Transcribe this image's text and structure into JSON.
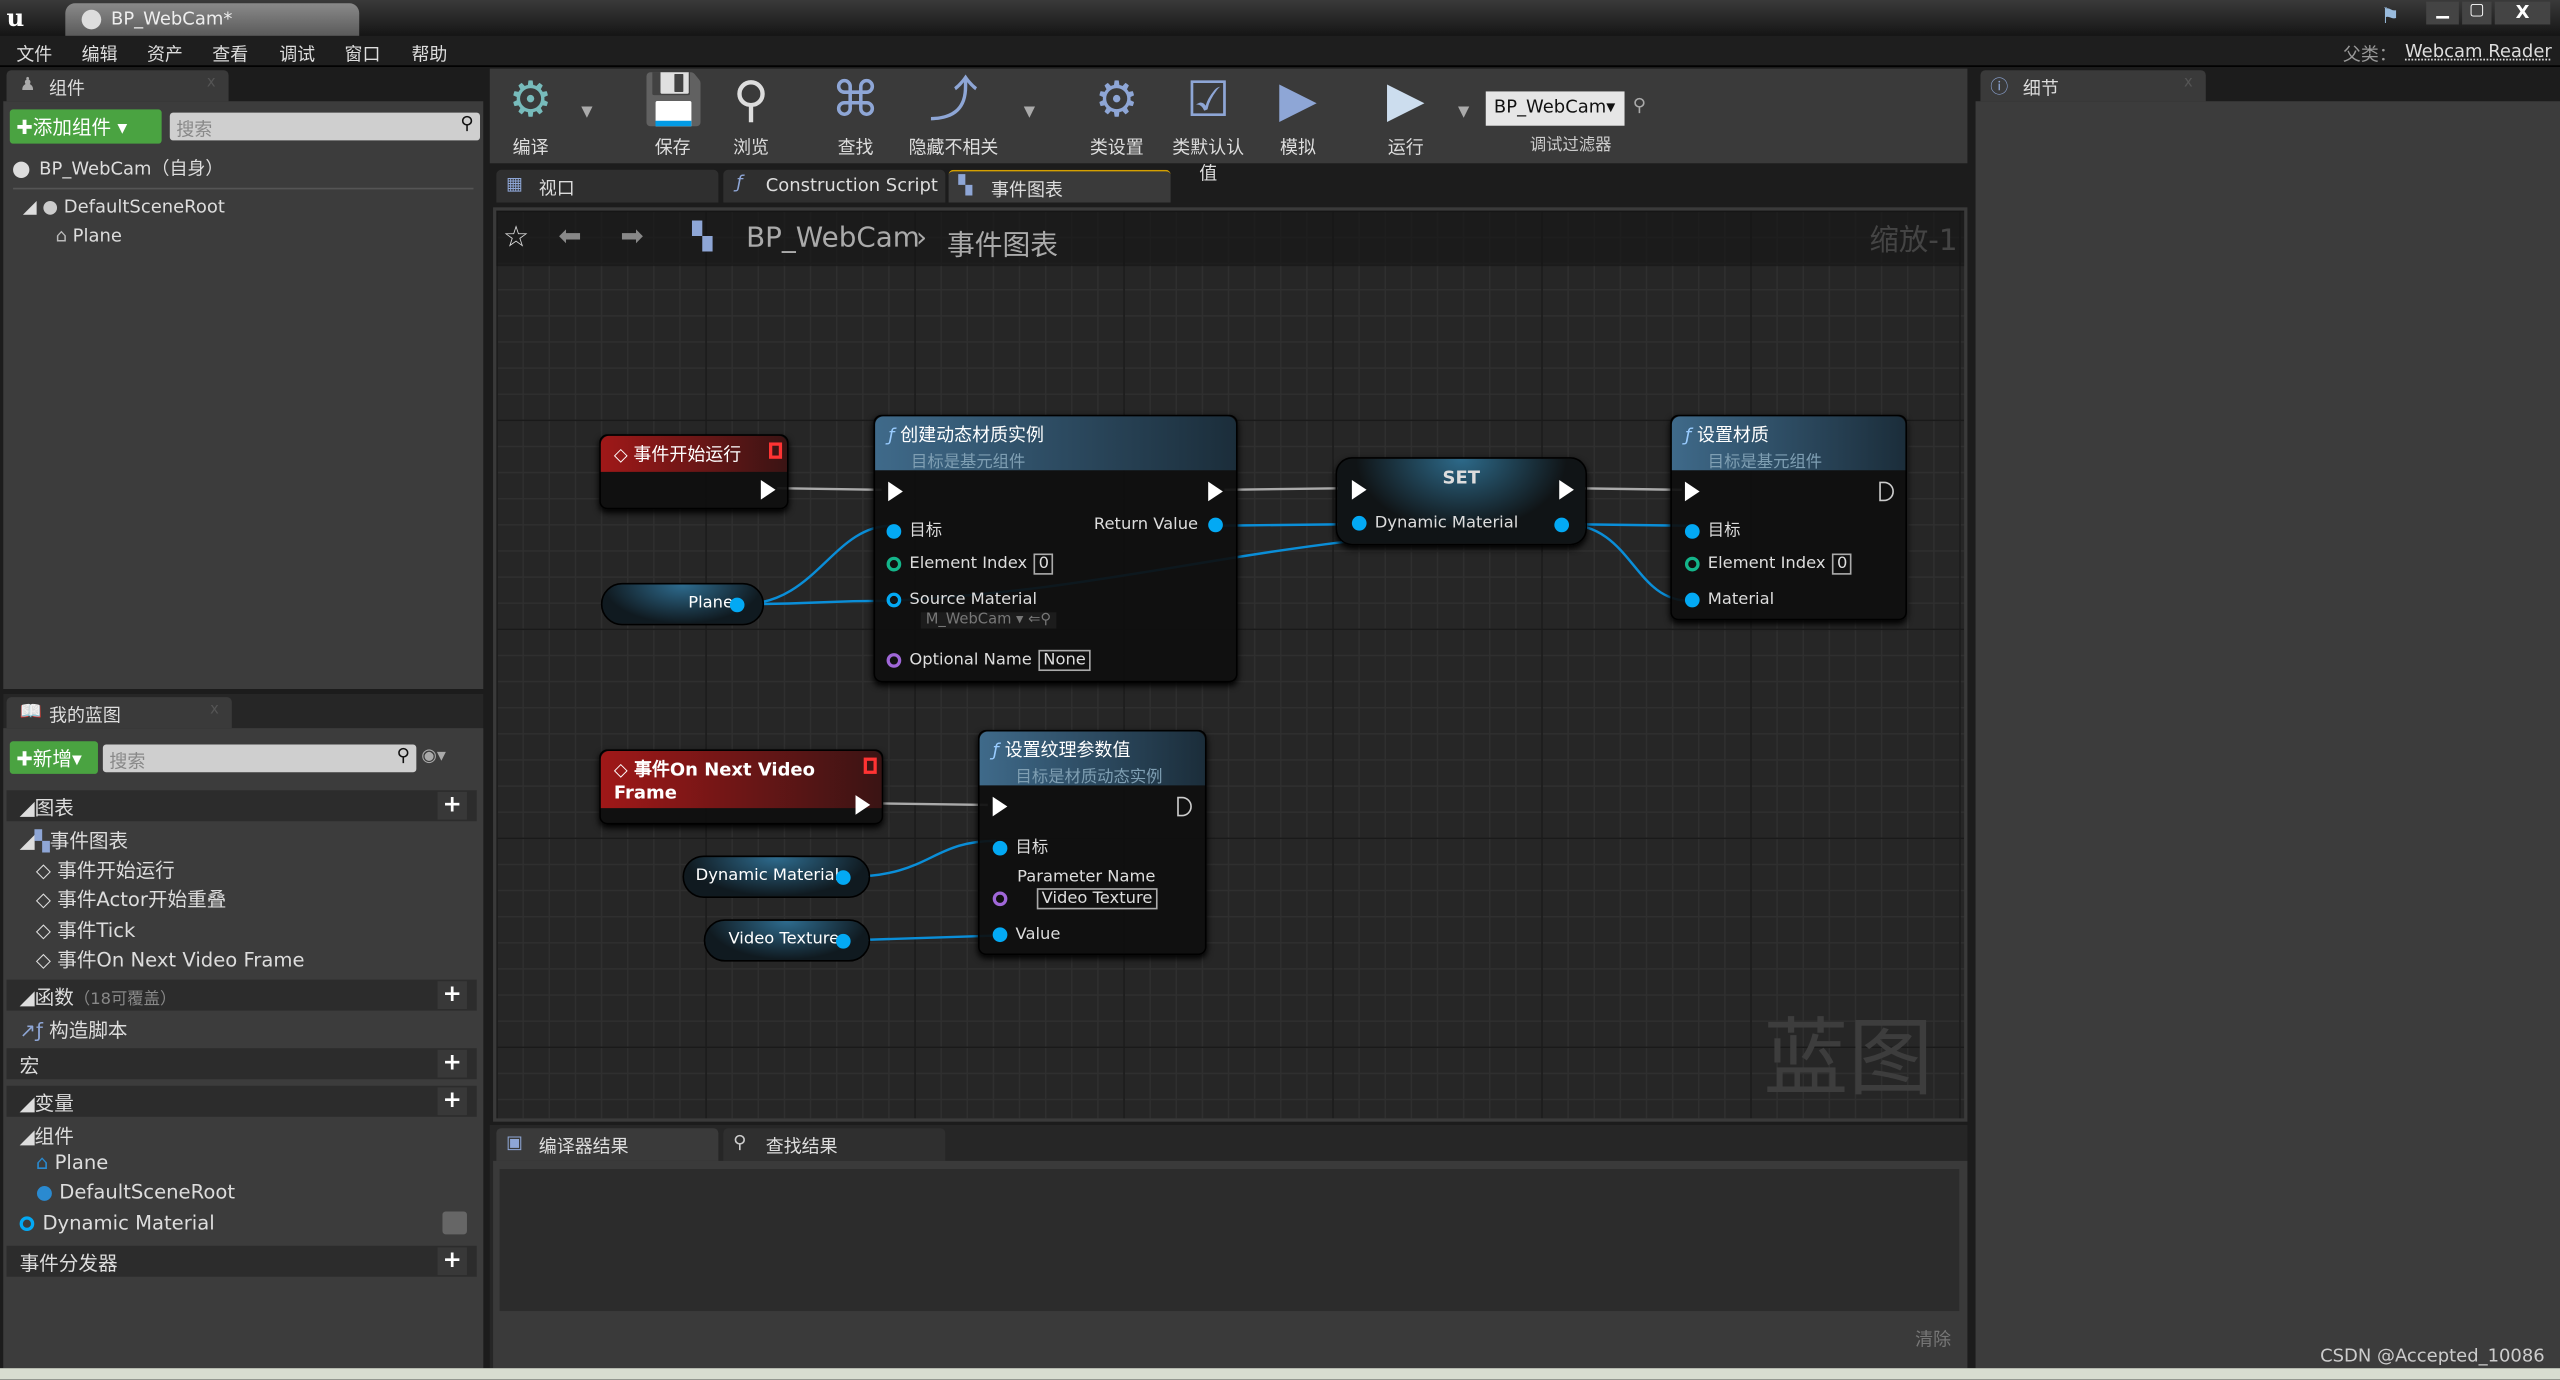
{
  "window": {
    "doc_tab": "BP_WebCam*",
    "parent_label": "父类：",
    "parent_value": "Webcam Reader"
  },
  "menu": [
    "文件",
    "编辑",
    "资产",
    "查看",
    "调试",
    "窗口",
    "帮助"
  ],
  "components": {
    "tab": "组件",
    "add_button": "添加组件",
    "search_placeholder": "搜索",
    "self": "BP_WebCam（自身）",
    "tree": [
      "DefaultSceneRoot",
      "Plane"
    ]
  },
  "toolbar": {
    "buttons": [
      "编译",
      "保存",
      "浏览",
      "查找",
      "隐藏不相关",
      "类设置",
      "类默认认值",
      "模拟",
      "运行"
    ],
    "debug_value": "BP_WebCam",
    "debug_label": "调试过滤器"
  },
  "graph_tabs": [
    "视口",
    "Construction Script",
    "事件图表"
  ],
  "breadcrumb": {
    "root": "BP_WebCam",
    "current": "事件图表",
    "zoom": "缩放-1"
  },
  "watermark": "蓝图",
  "nodes": {
    "begin": {
      "title": "事件开始运行"
    },
    "create": {
      "title": "创建动态材质实例",
      "subtitle": "目标是基元组件",
      "target": "目标",
      "return": "Return Value",
      "element_index": "Element Index",
      "element_index_value": "0",
      "source": "Source Material",
      "source_value": "M_WebCam",
      "optional": "Optional Name",
      "optional_value": "None"
    },
    "set": {
      "title": "SET",
      "pin": "Dynamic Material"
    },
    "setmat": {
      "title": "设置材质",
      "subtitle": "目标是基元组件",
      "target": "目标",
      "element_index": "Element Index",
      "element_index_value": "0",
      "material": "Material"
    },
    "plane": {
      "label": "Plane"
    },
    "frame": {
      "title": "事件On Next Video Frame"
    },
    "settex": {
      "title": "设置纹理参数值",
      "subtitle": "目标是材质动态实例",
      "target": "目标",
      "param": "Parameter Name",
      "param_value": "Video Texture",
      "value": "Value"
    },
    "dynvar": {
      "label": "Dynamic Material"
    },
    "texvar": {
      "label": "Video Texture"
    }
  },
  "bottom_tabs": [
    "编译器结果",
    "查找结果"
  ],
  "clear_label": "清除",
  "details_tab": "细节",
  "my_blueprint": {
    "tab": "我的蓝图",
    "new_button": "新增",
    "search_placeholder": "搜索",
    "graphs": "图表",
    "event_graph": "事件图表",
    "events": [
      "事件开始运行",
      "事件Actor开始重叠",
      "事件Tick",
      "事件On Next Video Frame"
    ],
    "functions": "函数",
    "functions_note": "（18可覆盖）",
    "construction": "构造脚本",
    "macros": "宏",
    "variables": "变量",
    "components_group": "组件",
    "component_vars": [
      "Plane",
      "DefaultSceneRoot"
    ],
    "dynamic_material": "Dynamic Material",
    "dispatchers": "事件分发器"
  },
  "watermark_credit": "CSDN @Accepted_10086"
}
